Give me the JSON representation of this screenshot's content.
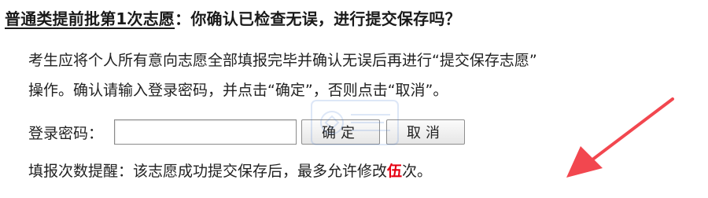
{
  "dialog": {
    "title_underlined": "普通类提前批第1次志愿",
    "title_rest": "：你确认已检查无误，进行提交保存吗？",
    "para_line1": "考生应将个人所有意向志愿全部填报完毕并确认无误后再进行“提交保存志愿”",
    "para_line2": "操作。确认请输入登录密码，并点击“确定”，否则点击“取消”。",
    "password_label": "登录密码：",
    "password_value": "",
    "ok_label": "确定",
    "cancel_label": "取消",
    "reminder_prefix": "填报次数提醒：该志愿成功提交保存后，最多允许修改",
    "reminder_count": "伍",
    "reminder_suffix": "次。"
  },
  "colors": {
    "highlight": "#e60012",
    "arrow": "#f2474f"
  },
  "icons": {
    "watermark": "logo-watermark-icon",
    "annotation": "red-arrow-icon"
  }
}
